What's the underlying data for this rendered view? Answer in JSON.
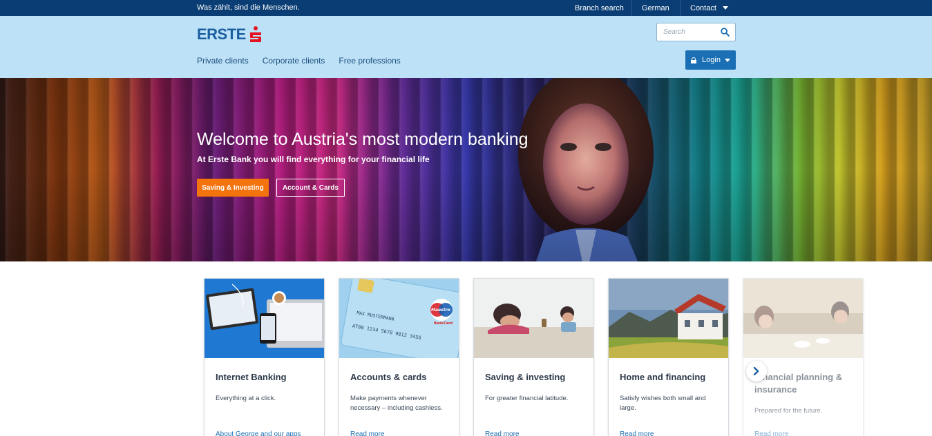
{
  "topbar": {
    "slogan": "Was zählt, sind die Menschen.",
    "branch_search": "Branch search",
    "language": "German",
    "contact": "Contact"
  },
  "header": {
    "logo_text": "ERSTE",
    "search_placeholder": "Search",
    "nav": [
      "Private clients",
      "Corporate clients",
      "Free professions"
    ],
    "login_label": "Login"
  },
  "hero": {
    "title": "Welcome to Austria's most modern banking",
    "subtitle": "At Erste Bank you will find everything for your financial life",
    "primary_button": "Saving & Investing",
    "secondary_button": "Account & Cards"
  },
  "cards": [
    {
      "title": "Internet Banking",
      "description": "Everything at a click.",
      "link": "About George and our apps"
    },
    {
      "title": "Accounts & cards",
      "description": "Make payments whenever necessary – including cashless.",
      "link": "Read more"
    },
    {
      "title": "Saving & investing",
      "description": "For greater financial latitude.",
      "link": "Read more"
    },
    {
      "title": "Home and financing",
      "description": "Satisfy wishes both small and large.",
      "link": "Read more"
    },
    {
      "title": "Financial planning & insurance",
      "description": "Prepared for the future.",
      "link": "Read more"
    }
  ],
  "card_images": {
    "card1": "Maestro",
    "card1_sub": "BankCard",
    "card1_holder": "MAX MUSTERMANN",
    "card1_number": "AT00 1234 5678 9012 3456"
  },
  "colors": {
    "topbar": "#0a3d74",
    "header": "#bde2f7",
    "brand_blue": "#1b5ea0",
    "brand_red": "#e3141f",
    "cta_orange": "#f3730d",
    "login_blue": "#1b6fb4"
  }
}
